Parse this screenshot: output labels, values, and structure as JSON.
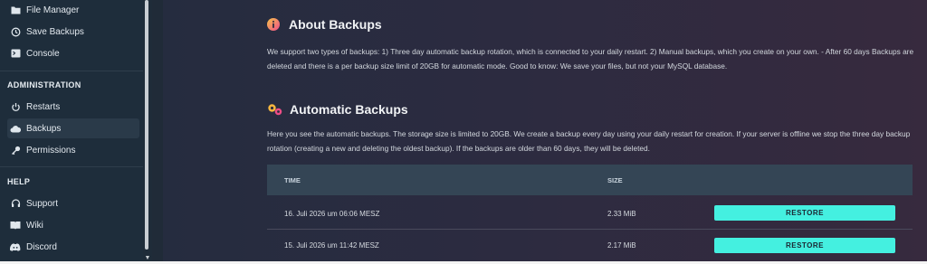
{
  "sidebar": {
    "items_top": [
      {
        "label": "File Manager",
        "icon": "folder-icon"
      },
      {
        "label": "Save Backups",
        "icon": "history-icon"
      },
      {
        "label": "Console",
        "icon": "terminal-icon"
      }
    ],
    "administration": {
      "heading": "ADMINISTRATION",
      "items": [
        {
          "label": "Restarts",
          "icon": "power-icon"
        },
        {
          "label": "Backups",
          "icon": "cloud-icon",
          "active": true
        },
        {
          "label": "Permissions",
          "icon": "key-icon"
        }
      ]
    },
    "help": {
      "heading": "HELP",
      "items": [
        {
          "label": "Support",
          "icon": "support-icon"
        },
        {
          "label": "Wiki",
          "icon": "book-icon"
        },
        {
          "label": "Discord",
          "icon": "discord-icon"
        }
      ]
    }
  },
  "about": {
    "icon": "info-icon",
    "title": "About Backups",
    "text": "We support two types of backups: 1) Three day automatic backup rotation, which is connected to your daily restart. 2) Manual backups, which you create on your own. - After 60 days Backups are deleted and there is a per backup size limit of 20GB for automatic mode. Good to know: We save your files, but not your MySQL database."
  },
  "automatic": {
    "icon": "gears-icon",
    "title": "Automatic Backups",
    "text": "Here you see the automatic backups. The storage size is limited to 20GB. We create a backup every day using your daily restart for creation. If your server is offline we stop the three day backup rotation (creating a new and deleting the oldest backup). If the backups are older than 60 days, they will be deleted."
  },
  "table": {
    "headers": {
      "time": "TIME",
      "size": "SIZE"
    },
    "rows": [
      {
        "time": "16. Juli 2026 um 06:06 MESZ",
        "size": "2.33 MiB",
        "action": "RESTORE"
      },
      {
        "time": "15. Juli 2026 um 11:42 MESZ",
        "size": "2.17 MiB",
        "action": "RESTORE"
      }
    ]
  },
  "colors": {
    "sidebar_bg": "#1e2d3b",
    "restore_button": "#44f0e0",
    "table_header_bg": "#344555"
  }
}
